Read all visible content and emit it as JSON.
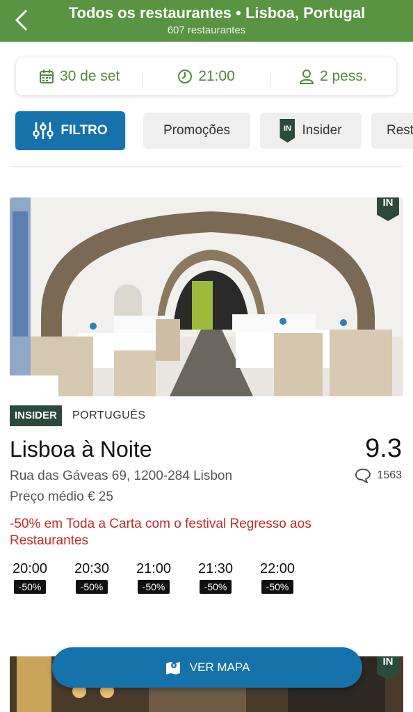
{
  "header": {
    "title": "Todos os restaurantes • Lisboa, Portugal",
    "subtitle": "607 restaurantes",
    "back_icon": "chevron-left-icon"
  },
  "booking": {
    "date": "30 de set",
    "time": "21:00",
    "people": "2 pess.",
    "accent_color": "#4d8a39"
  },
  "filters": {
    "filter_label": "FILTRO",
    "promotions_label": "Promoções",
    "insider_label": "Insider",
    "insider_badge": "IN",
    "next_label": "Rest"
  },
  "restaurant": {
    "in_badge": "IN",
    "insider_tag": "INSIDER",
    "cuisine": "PORTUGUÊS",
    "name": "Lisboa à Noite",
    "score": "9.3",
    "address": "Rua das Gáveas 69, 1200-284 Lisbon",
    "reviews": "1563",
    "price": "Preço médio € 25",
    "promo": "-50% em Toda a Carta com o festival Regresso aos Restaurantes",
    "slots": [
      {
        "time": "20:00",
        "discount": "-50%"
      },
      {
        "time": "20:30",
        "discount": "-50%"
      },
      {
        "time": "21:00",
        "discount": "-50%"
      },
      {
        "time": "21:30",
        "discount": "-50%"
      },
      {
        "time": "22:00",
        "discount": "-50%"
      }
    ]
  },
  "next_restaurant": {
    "in_badge": "IN"
  },
  "map_button": {
    "label": "VER MAPA"
  },
  "colors": {
    "header_green": "#589442",
    "primary_blue": "#1572ab",
    "insider_dark": "#2b4a3c",
    "promo_red": "#c62828"
  }
}
